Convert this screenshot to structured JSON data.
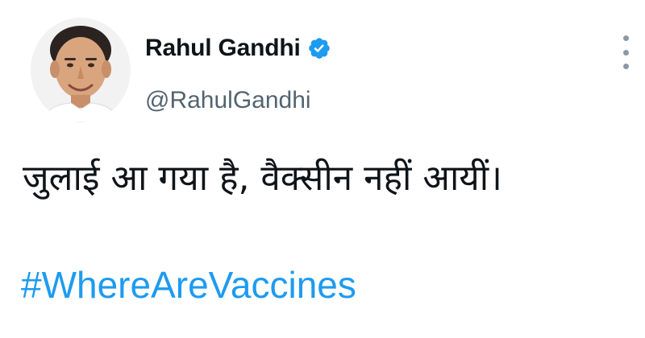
{
  "tweet": {
    "author": {
      "display_name": "Rahul Gandhi",
      "handle": "@RahulGandhi",
      "verified": true
    },
    "text": "जुलाई आ गया है, वैक्सीन नहीं आयीं।",
    "hashtag": "#WhereAreVaccines"
  },
  "icons": {
    "avatar": "profile-photo",
    "verified": "verified-badge-icon",
    "more": "more-options-icon"
  },
  "colors": {
    "hashtag": "#1d9bf0",
    "verified_badge": "#1d9bf0",
    "handle": "#536471",
    "text": "#0f1419"
  }
}
